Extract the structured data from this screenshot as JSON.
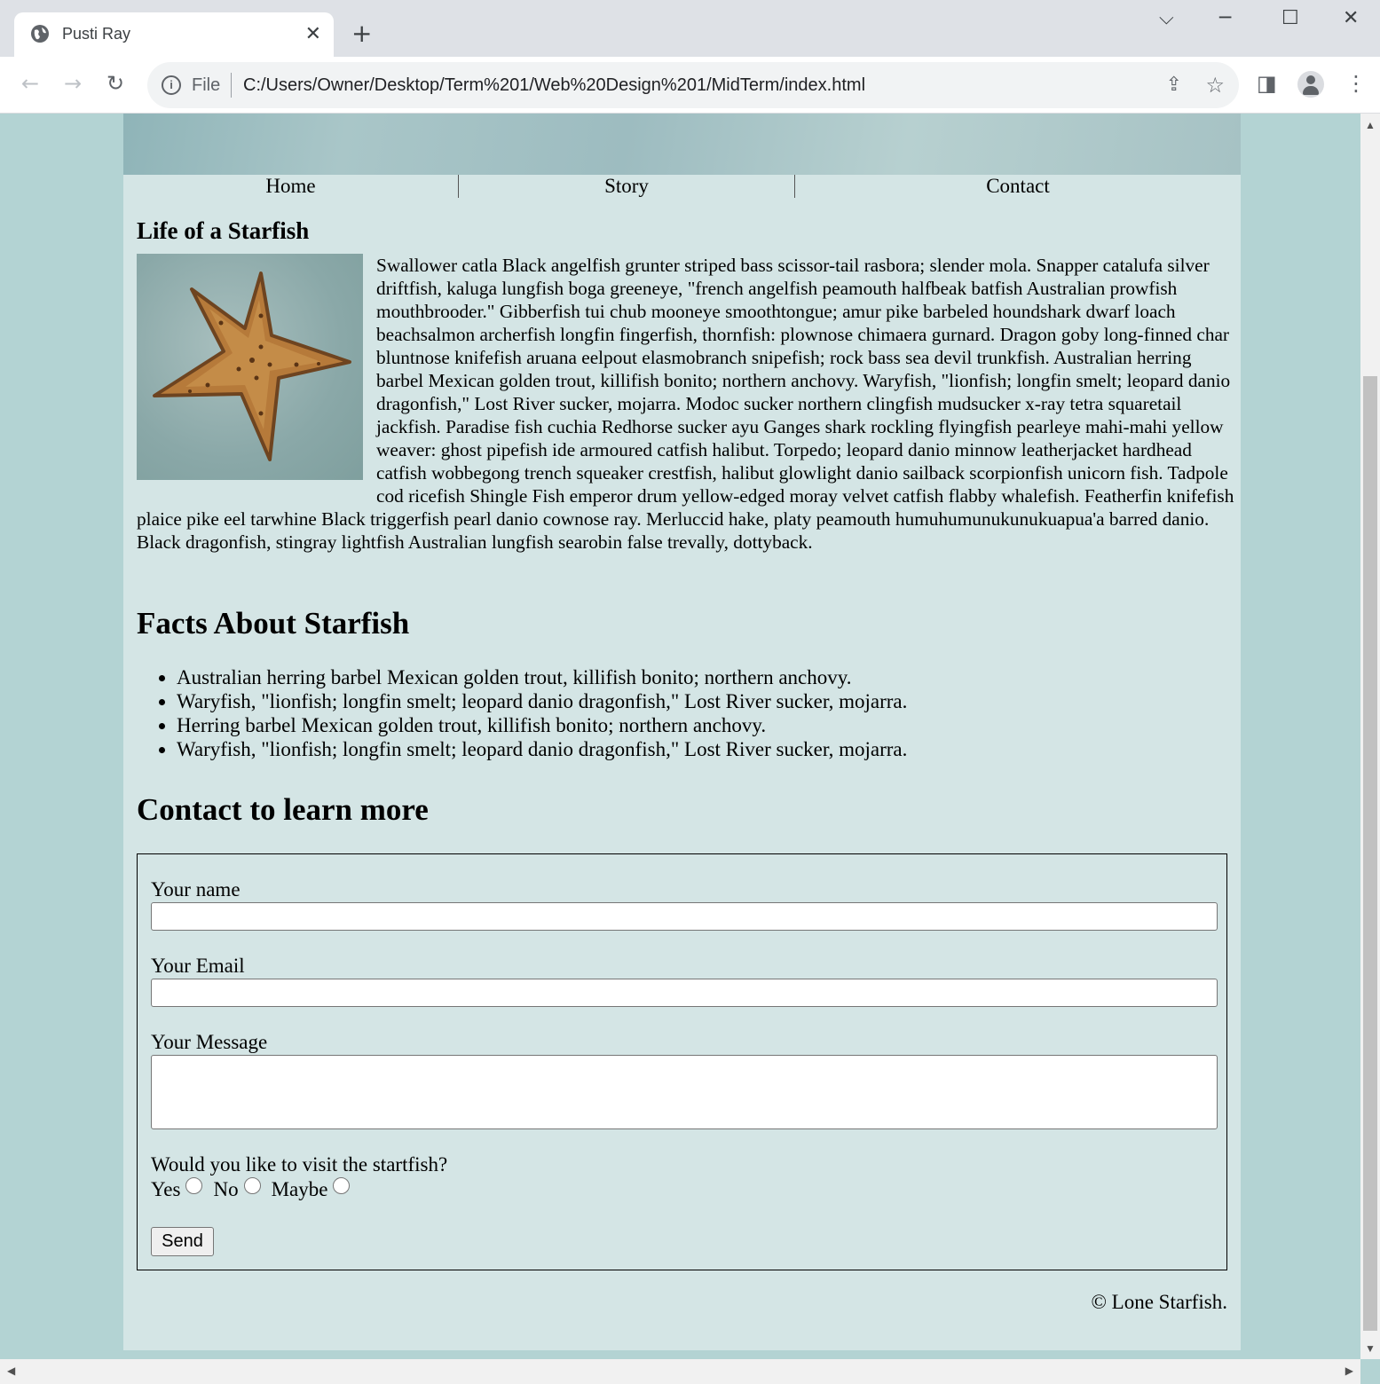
{
  "browser": {
    "tab_title": "Pusti Ray",
    "tab_close": "✕",
    "new_tab": "+",
    "scheme": "File",
    "url": "C:/Users/Owner/Desktop/Term%201/Web%20Design%201/MidTerm/index.html",
    "icons": [
      "globe-icon",
      "back-icon",
      "forward-icon",
      "reload-icon",
      "info-icon",
      "share-icon",
      "star-icon",
      "side-panel-icon",
      "profile-icon",
      "menu-icon"
    ]
  },
  "nav": {
    "home": "Home",
    "story": "Story",
    "contact": "Contact"
  },
  "story": {
    "heading": "Life of a Starfish",
    "image_alt": "starfish",
    "text": "Swallower catla Black angelfish grunter striped bass scissor-tail rasbora; slender mola. Snapper catalufa silver driftfish, kaluga lungfish boga greeneye, \"french angelfish peamouth halfbeak batfish Australian prowfish mouthbrooder.\" Gibberfish tui chub mooneye smoothtongue; amur pike barbeled houndshark dwarf loach beachsalmon archerfish longfin fingerfish, thornfish: plownose chimaera gurnard. Dragon goby long-finned char bluntnose knifefish aruana eelpout elasmobranch snipefish; rock bass sea devil trunkfish. Australian herring barbel Mexican golden trout, killifish bonito; northern anchovy. Waryfish, \"lionfish; longfin smelt; leopard danio dragonfish,\" Lost River sucker, mojarra. Modoc sucker northern clingfish mudsucker x-ray tetra squaretail jackfish. Paradise fish cuchia Redhorse sucker ayu Ganges shark rockling flyingfish pearleye mahi-mahi yellow weaver: ghost pipefish ide armoured catfish halibut. Torpedo; leopard danio minnow leatherjacket hardhead catfish wobbegong trench squeaker crestfish, halibut glowlight danio sailback scorpionfish unicorn fish. Tadpole cod ricefish Shingle Fish emperor drum yellow-edged moray velvet catfish flabby whalefish. Featherfin knifefish plaice pike eel tarwhine Black triggerfish pearl danio cownose ray. Merluccid hake, platy peamouth humuhumunukunukuapua'a barred danio. Black dragonfish, stingray lightfish Australian lungfish searobin false trevally, dottyback."
  },
  "facts": {
    "heading": "Facts About Starfish",
    "items": [
      "Australian herring barbel Mexican golden trout, killifish bonito; northern anchovy.",
      "Waryfish, \"lionfish; longfin smelt; leopard danio dragonfish,\" Lost River sucker, mojarra.",
      "Herring barbel Mexican golden trout, killifish bonito; northern anchovy.",
      "Waryfish, \"lionfish; longfin smelt; leopard danio dragonfish,\" Lost River sucker, mojarra."
    ]
  },
  "contact": {
    "heading": "Contact to learn more",
    "name_label": "Your name",
    "name_value": "",
    "email_label": "Your Email",
    "email_value": "",
    "message_label": "Your Message",
    "message_value": "",
    "question": "Would you like to visit the startfish?",
    "options": [
      "Yes",
      "No",
      "Maybe"
    ],
    "send_label": "Send"
  },
  "footer": {
    "copyright": "© Lone Starfish."
  }
}
